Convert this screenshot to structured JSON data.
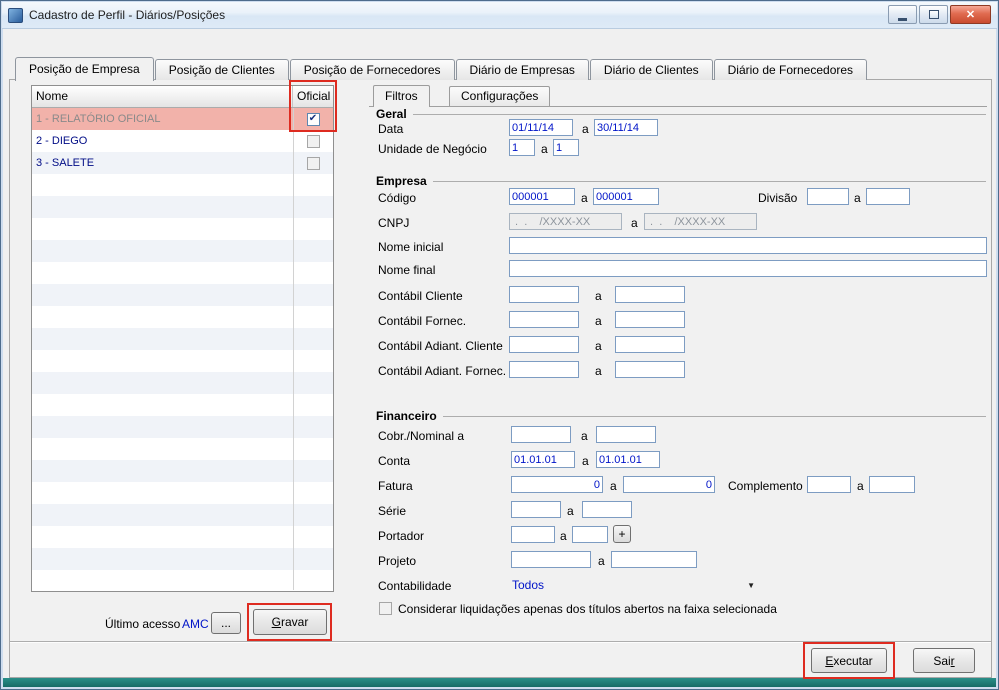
{
  "window": {
    "title": "Cadastro de Perfil - Diários/Posições"
  },
  "icons": {
    "check": "✔",
    "dropdown_arrow": "▼",
    "close": "✕"
  },
  "tabs": [
    "Posição de Empresa",
    "Posição de Clientes",
    "Posição de Fornecedores",
    "Diário de Empresas",
    "Diário de Clientes",
    "Diário de Fornecedores"
  ],
  "grid": {
    "columns": [
      "Nome",
      "Oficial"
    ],
    "rows": [
      {
        "nome": "1 - RELATÓRIO OFICIAL",
        "oficial": true
      },
      {
        "nome": "2 - DIEGO",
        "oficial": false
      },
      {
        "nome": "3 - SALETE",
        "oficial": false
      }
    ]
  },
  "access": {
    "label": "Último acesso",
    "value": "AMC",
    "browse": "...",
    "gravar": "Gravar"
  },
  "inner_tabs": [
    "Filtros",
    "Configurações"
  ],
  "sep": "a",
  "geral": {
    "title": "Geral",
    "data": {
      "label": "Data",
      "from": "01/11/14",
      "to": "30/11/14"
    },
    "unidade": {
      "label": "Unidade de Negócio",
      "from": "1",
      "to": "1"
    }
  },
  "empresa": {
    "title": "Empresa",
    "codigo": {
      "label": "Código",
      "from": "000001",
      "to": "000001"
    },
    "divisao": {
      "label": "Divisão",
      "from": "",
      "to": ""
    },
    "cnpj": {
      "label": "CNPJ",
      "from": " .  .    /XXXX-XX",
      "to": " .  .    /XXXX-XX"
    },
    "nome_inicial": {
      "label": "Nome inicial",
      "value": ""
    },
    "nome_final": {
      "label": "Nome final",
      "value": ""
    },
    "contabil_cliente": {
      "label": "Contábil Cliente",
      "from": "",
      "to": ""
    },
    "contabil_fornec": {
      "label": "Contábil Fornec.",
      "from": "",
      "to": ""
    },
    "contabil_adiant_cliente": {
      "label": "Contábil Adiant. Cliente",
      "from": "",
      "to": ""
    },
    "contabil_adiant_fornec": {
      "label": "Contábil Adiant. Fornec.",
      "from": "",
      "to": ""
    }
  },
  "financeiro": {
    "title": "Financeiro",
    "cobr_nominal": {
      "label": "Cobr./Nominal a",
      "from": "",
      "to": ""
    },
    "conta": {
      "label": "Conta",
      "from": "01.01.01",
      "to": "01.01.01"
    },
    "fatura": {
      "label": "Fatura",
      "from": "0",
      "to": "0"
    },
    "complemento": {
      "label": "Complemento",
      "from": "",
      "to": ""
    },
    "serie": {
      "label": "Série",
      "from": "",
      "to": ""
    },
    "portador": {
      "label": "Portador",
      "from": "",
      "to": "",
      "plus": "+"
    },
    "projeto": {
      "label": "Projeto",
      "from": "",
      "to": ""
    },
    "contabilidade": {
      "label": "Contabilidade",
      "value": "Todos"
    },
    "liquidacoes": {
      "label": "Considerar liquidações apenas dos títulos abertos na faixa selecionada",
      "checked": false
    }
  },
  "footer": {
    "executar": "Executar",
    "sair_pre": "Sai",
    "sair_accel": "r"
  }
}
